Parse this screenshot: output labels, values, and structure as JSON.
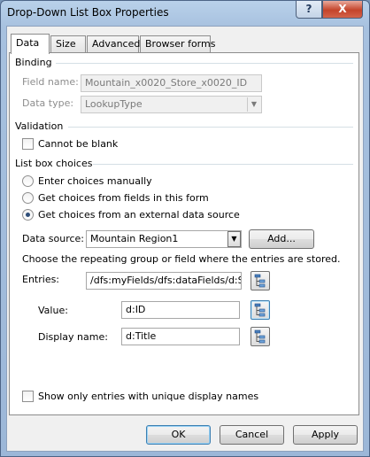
{
  "window": {
    "title": "Drop-Down List Box Properties",
    "help_label": "?",
    "close_label": "X"
  },
  "tabs": [
    {
      "label": "Data",
      "active": true
    },
    {
      "label": "Size",
      "active": false
    },
    {
      "label": "Advanced",
      "active": false
    },
    {
      "label": "Browser forms",
      "active": false
    }
  ],
  "binding": {
    "heading": "Binding",
    "field_name_label": "Field name:",
    "field_name_value": "Mountain_x0020_Store_x0020_ID",
    "data_type_label": "Data type:",
    "data_type_value": "LookupType"
  },
  "validation": {
    "heading": "Validation",
    "cannot_be_blank_label": "Cannot be blank",
    "cannot_be_blank_checked": false
  },
  "choices": {
    "heading": "List box choices",
    "options": [
      {
        "label": "Enter choices manually",
        "selected": false
      },
      {
        "label": "Get choices from fields in this form",
        "selected": false
      },
      {
        "label": "Get choices from an external data source",
        "selected": true
      }
    ],
    "data_source_label": "Data source:",
    "data_source_value": "Mountain Region1",
    "add_button": "Add...",
    "instruction": "Choose the repeating group or field where the entries are stored.",
    "entries_label": "Entries:",
    "entries_value": "/dfs:myFields/dfs:dataFields/d:Sha",
    "value_label": "Value:",
    "value_value": "d:ID",
    "display_name_label": "Display name:",
    "display_name_value": "d:Title",
    "unique_label": "Show only entries with unique display names",
    "unique_checked": false
  },
  "footer": {
    "ok": "OK",
    "cancel": "Cancel",
    "apply": "Apply"
  },
  "icons": {
    "picker": "tree-picker-icon",
    "dropdown": "chevron-down-icon"
  }
}
